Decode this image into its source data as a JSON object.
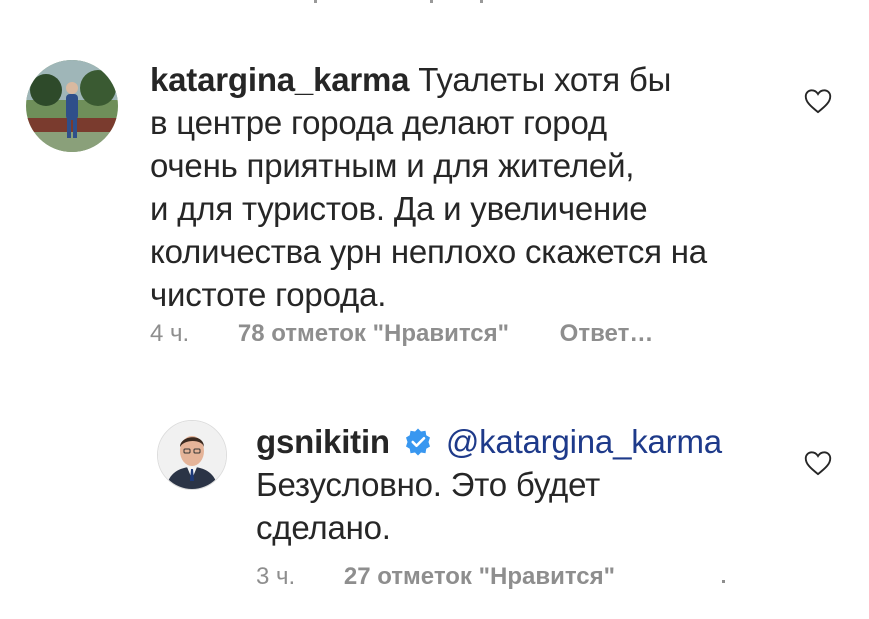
{
  "comment1": {
    "username": "katargina_karma",
    "text_line1": " Туалеты хотя бы",
    "text_line2": "в центре города делают город",
    "text_line3": "очень приятным и для жителей,",
    "text_line4": "и для туристов. Да и увеличение",
    "text_line5": "количества урн неплохо скажется на",
    "text_line6": "чистоте города.",
    "time": "4 ч.",
    "likes": "78 отметок \"Нравится\"",
    "reply": "Ответ…"
  },
  "comment2": {
    "username": "gsnikitin",
    "mention": "@katargina_karma",
    "text_line1": "Безусловно. Это будет",
    "text_line2": "сделано.",
    "time": "3 ч.",
    "likes": "27 отметок \"Нравится\""
  },
  "icons": {
    "heart": "heart-outline-icon",
    "verified": "verified-badge-icon"
  },
  "colors": {
    "text": "#262626",
    "meta": "#8e8e8e",
    "mention": "#1e3a8a",
    "verified": "#3897f0"
  }
}
